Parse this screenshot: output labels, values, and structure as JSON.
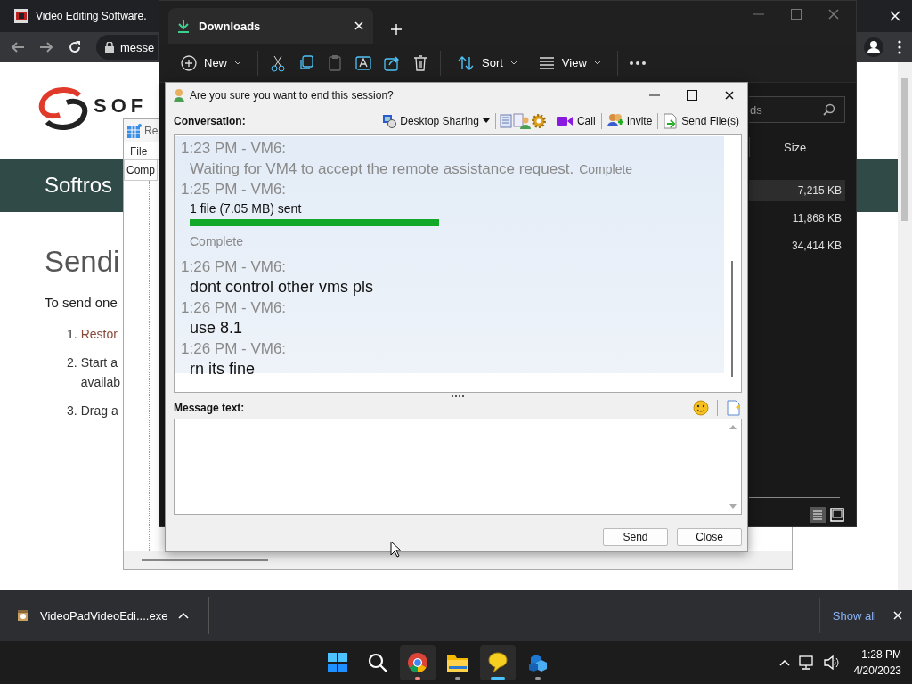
{
  "browser": {
    "tab_title": "Video Editing Software.",
    "address": "messe",
    "page": {
      "logo_text": "SOF",
      "banner_title": "Softros",
      "heading": "Sendi",
      "intro": "To send one",
      "steps": [
        {
          "number": "1.",
          "lines": [
            "Restor"
          ],
          "link": true
        },
        {
          "number": "2.",
          "lines": [
            "Start a",
            "availab"
          ],
          "link": false
        },
        {
          "number": "3.",
          "lines": [
            "Drag a"
          ],
          "link": false
        }
      ]
    }
  },
  "download_bar": {
    "file_name": "VideoPadVideoEdi....exe",
    "show_all": "Show all"
  },
  "back_window": {
    "title": "Re",
    "menu": "File",
    "tab": "Comp"
  },
  "explorer": {
    "tab_title": "Downloads",
    "toolbar": [
      {
        "label": "New",
        "kind": "new"
      },
      {
        "label": "Sort",
        "kind": "sort"
      },
      {
        "label": "View",
        "kind": "view"
      }
    ],
    "search_placeholder": "ds",
    "column": "Size",
    "rows": [
      {
        "size": "7,215 KB",
        "selected": true
      },
      {
        "size": "11,868 KB",
        "selected": false
      },
      {
        "size": "34,414 KB",
        "selected": false
      }
    ]
  },
  "messenger": {
    "title": "Are you sure you want to end this session?",
    "conversation_label": "Conversation:",
    "tools": [
      {
        "label": "Desktop Sharing",
        "kind": "sharing"
      },
      {
        "label": "Call",
        "kind": "call"
      },
      {
        "label": "Invite",
        "kind": "invite"
      },
      {
        "label": "Send File(s)",
        "kind": "send-file"
      }
    ],
    "messages": [
      {
        "header": "1:23 PM - VM6:",
        "kind": "system",
        "text": "Waiting for VM4 to accept the remote assistance request.",
        "status": "Complete"
      },
      {
        "header": "1:25 PM - VM6:",
        "kind": "file",
        "text": "1 file (7.05 MB) sent",
        "status": "Complete"
      },
      {
        "header": "1:26 PM - VM6:",
        "kind": "message",
        "text": "dont control other vms pls"
      },
      {
        "header": "1:26 PM - VM6:",
        "kind": "message",
        "text": "use 8.1"
      },
      {
        "header": "1:26 PM - VM6:",
        "kind": "message",
        "text": "rn its fine"
      }
    ],
    "message_label": "Message text:",
    "buttons": [
      "Send",
      "Close"
    ]
  },
  "taskbar": {
    "apps": [
      {
        "kind": "start",
        "running": false,
        "selected": false,
        "attention": false
      },
      {
        "kind": "search",
        "running": false,
        "selected": false,
        "attention": false
      },
      {
        "kind": "browser",
        "running": true,
        "selected": false,
        "attention": true
      },
      {
        "kind": "folder",
        "running": true,
        "selected": false,
        "attention": false
      },
      {
        "kind": "chat",
        "running": true,
        "selected": true,
        "attention": false
      },
      {
        "kind": "cube",
        "running": true,
        "selected": false,
        "attention": false
      }
    ],
    "time": "1:28 PM",
    "date": "4/20/2023"
  }
}
